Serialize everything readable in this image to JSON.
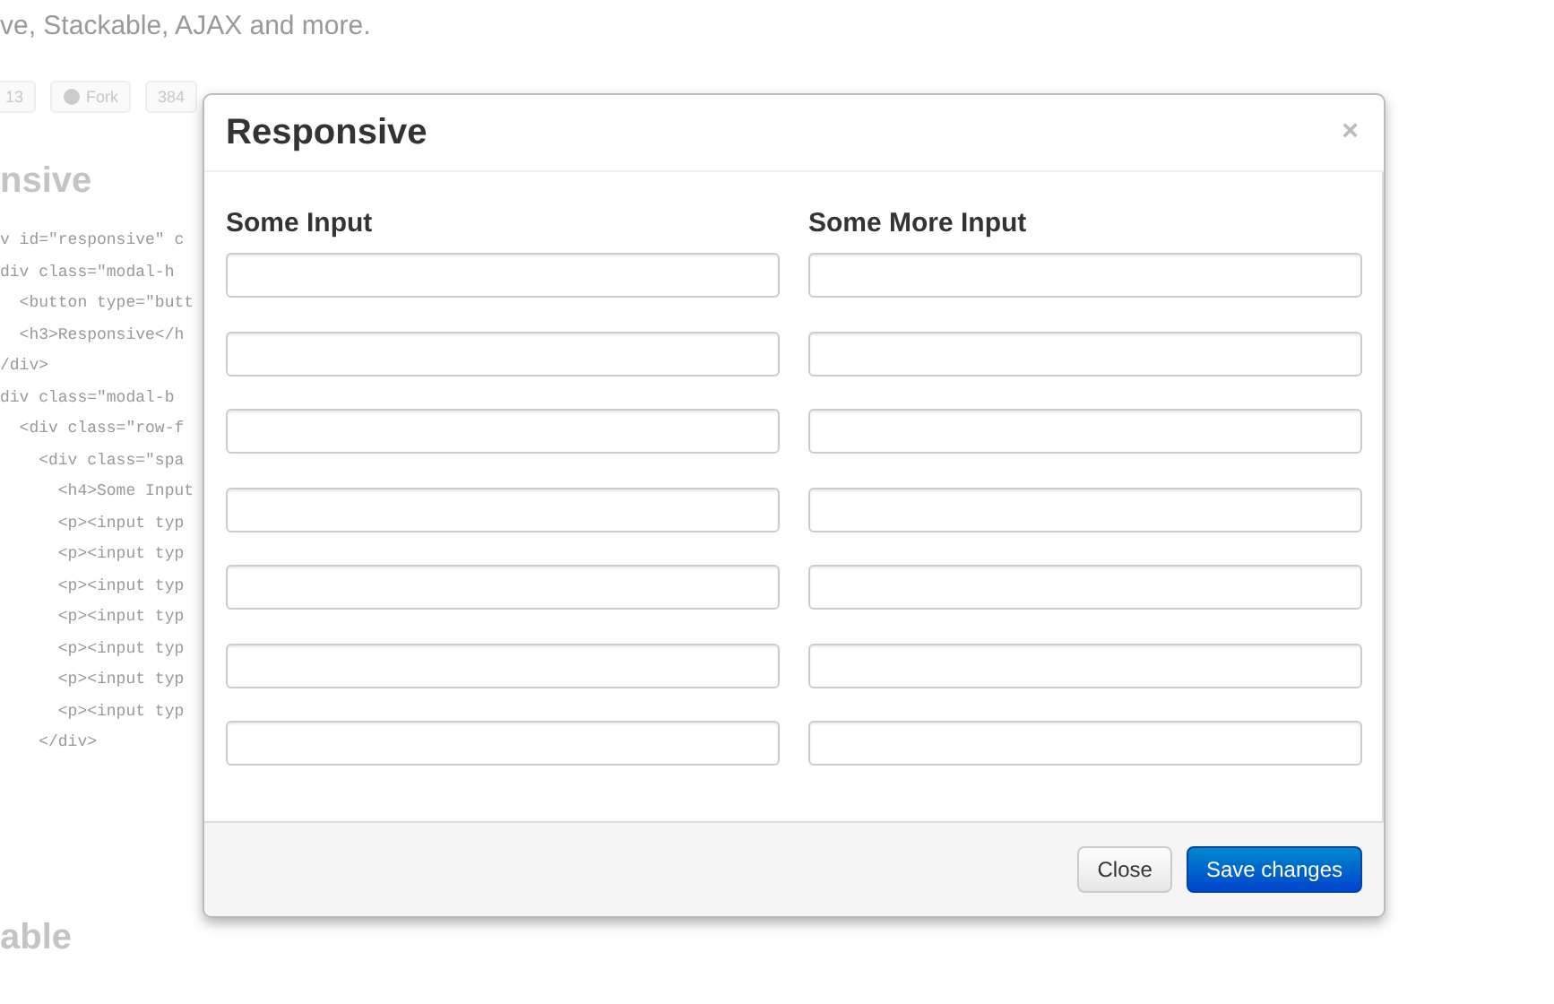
{
  "background": {
    "tagline": "ve, Stackable, AJAX and more.",
    "social": [
      {
        "kind": "count",
        "text": "13"
      },
      {
        "kind": "fork",
        "text": "Fork"
      },
      {
        "kind": "count",
        "text": "384"
      }
    ],
    "heading": "nsive",
    "code_lines": [
      "v id=\"responsive\" c",
      "div class=\"modal-h",
      "  <button type=\"butt",
      "  <h3>Responsive</h",
      "/div>",
      "div class=\"modal-b",
      "  <div class=\"row-f",
      "    <div class=\"spa",
      "      <h4>Some Input",
      "      <p><input typ",
      "      <p><input typ",
      "      <p><input typ",
      "      <p><input typ",
      "      <p><input typ",
      "      <p><input typ",
      "      <p><input typ",
      "    </div>"
    ],
    "heading_2": "able"
  },
  "modal": {
    "title": "Responsive",
    "close": "×",
    "columns": [
      {
        "label": "Some Input",
        "fields": [
          {
            "kind": "text"
          },
          {
            "kind": "text"
          },
          {
            "kind": "text"
          },
          {
            "kind": "text"
          },
          {
            "kind": "text"
          },
          {
            "kind": "text"
          },
          {
            "kind": "text"
          }
        ]
      },
      {
        "label": "Some More Input",
        "fields": [
          {
            "kind": "text"
          },
          {
            "kind": "text"
          },
          {
            "kind": "text"
          },
          {
            "kind": "text"
          },
          {
            "kind": "text"
          },
          {
            "kind": "text"
          },
          {
            "kind": "text"
          }
        ]
      }
    ],
    "buttons": [
      {
        "label": "Close",
        "kind": "default"
      },
      {
        "label": "Save changes",
        "kind": "primary"
      }
    ]
  }
}
